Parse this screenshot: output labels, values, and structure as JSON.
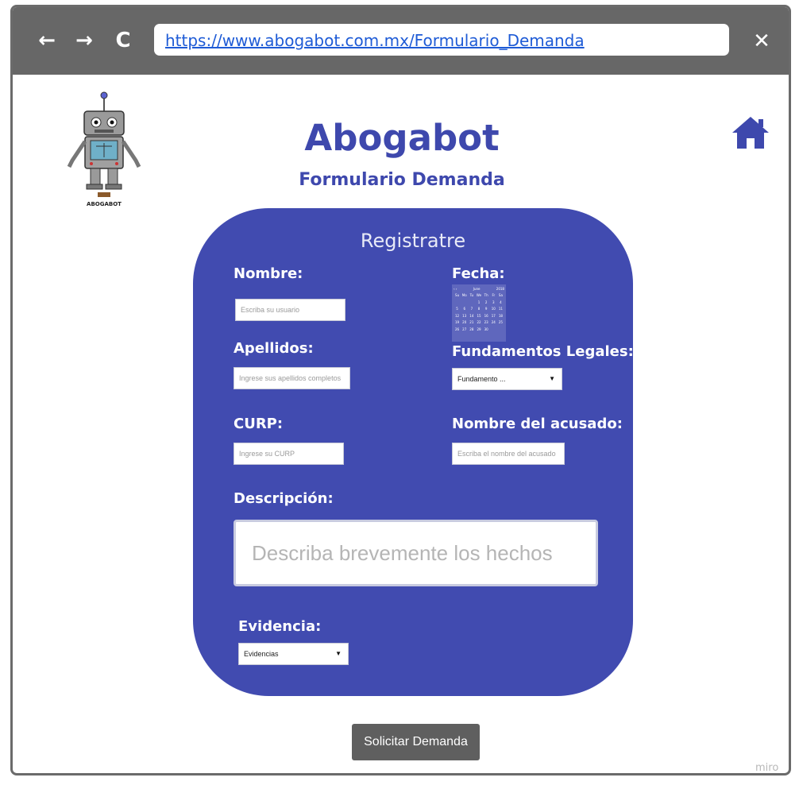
{
  "browser": {
    "url": "https://www.abogabot.com.mx/Formulario_Demanda",
    "back_icon": "←",
    "forward_icon": "→",
    "reload_icon": "C",
    "close_icon": "✕"
  },
  "header": {
    "title": "Abogabot",
    "subtitle": "Formulario Demanda",
    "logo_text": "ABOGABOT"
  },
  "form": {
    "title": "Registratre",
    "nombre_label": "Nombre:",
    "nombre_placeholder": "Escriba su usuario",
    "apellidos_label": "Apellidos:",
    "apellidos_placeholder": "Ingrese sus apellidos completos",
    "curp_label": "CURP:",
    "curp_placeholder": "Ingrese su CURP",
    "fecha_label": "Fecha:",
    "fundamentos_label": "Fundamentos Legales:",
    "fundamentos_selected": "Fundamento ...",
    "acusado_label": "Nombre del acusado:",
    "acusado_placeholder": "Escriba el nombre del acusado",
    "descripcion_label": "Descripción:",
    "descripcion_placeholder": "Describa brevemente los hechos",
    "evidencia_label": "Evidencia:",
    "evidencia_selected": "Evidencias"
  },
  "calendar": {
    "month": "June",
    "year": "2018",
    "days": [
      "Su",
      "Mo",
      "Tu",
      "We",
      "Th",
      "Fr",
      "Sa"
    ],
    "weeks": [
      [
        "",
        "",
        "",
        "",
        "1",
        "2",
        "3",
        "4"
      ],
      [
        "",
        "5",
        "6",
        "7",
        "8",
        "9",
        "10"
      ]
    ]
  },
  "submit_label": "Solicitar Demanda",
  "watermark": "miro",
  "colors": {
    "accent": "#414bb0",
    "title": "#3e48ad",
    "browser_bar": "#676767",
    "button": "#5f5f5f"
  }
}
